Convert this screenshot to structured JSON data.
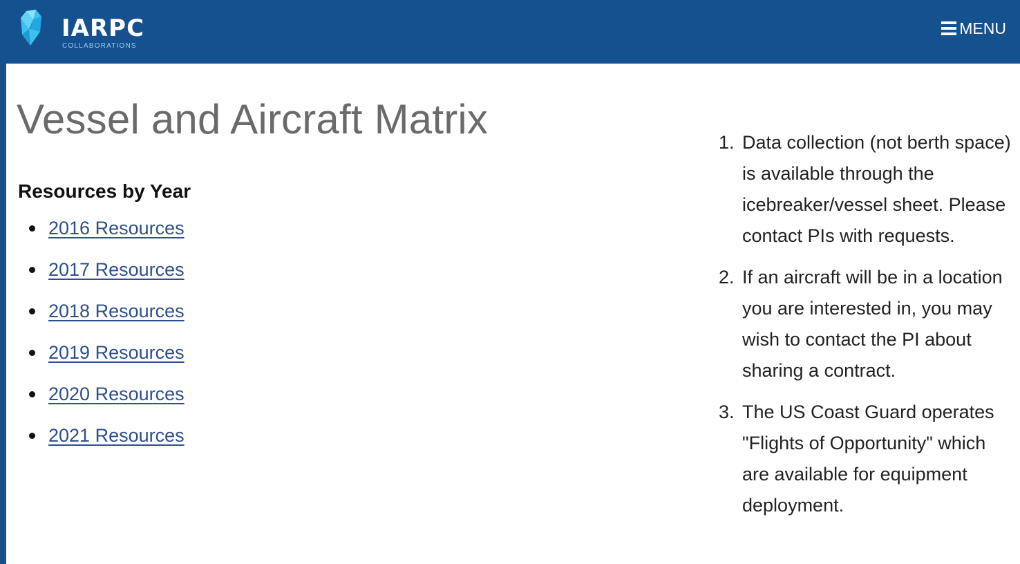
{
  "header": {
    "logo_name": "IARPC",
    "logo_sub": "COLLABORATIONS",
    "menu_label": "MENU",
    "colors": {
      "bar": "#15508f",
      "logo_accent": "#3cc0f0"
    }
  },
  "main": {
    "title": "Vessel and Aircraft Matrix",
    "resources_heading": "Resources by Year",
    "resources": [
      {
        "label": "2016 Resources"
      },
      {
        "label": "2017 Resources"
      },
      {
        "label": "2018 Resources"
      },
      {
        "label": "2019 Resources"
      },
      {
        "label": "2020 Resources"
      },
      {
        "label": "2021 Resources"
      }
    ],
    "notes": [
      {
        "number": "1.",
        "text": "Data collection (not berth space) is available through the icebreaker/vessel sheet. Please contact PIs with requests."
      },
      {
        "number": "2.",
        "text": "If an aircraft will be in a location you are interested in, you may wish to contact the PI about sharing a contract."
      },
      {
        "number": "3.",
        "text": "The US Coast Guard operates \"Flights of Opportunity\" which are available for equipment deployment."
      }
    ]
  }
}
